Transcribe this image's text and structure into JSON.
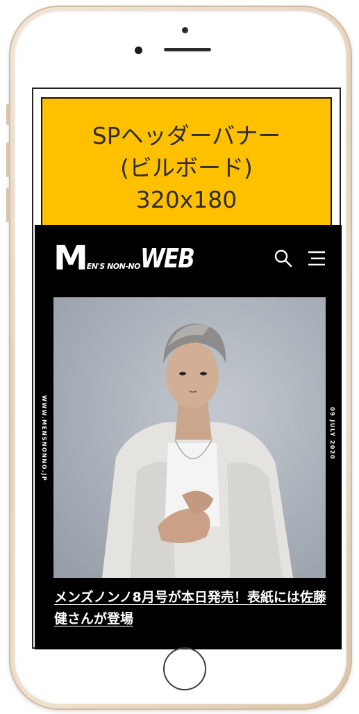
{
  "banner": {
    "line1": "SPヘッダーバナー",
    "line2": "(ビルボード)",
    "line3": "320x180",
    "color": "#ffc000"
  },
  "site": {
    "logo_m": "M",
    "logo_mid": "EN'S NON-NO",
    "logo_web": "WEB",
    "search_icon": "search-icon",
    "menu_icon": "hamburger-menu-icon",
    "side_left_text": "WWW.MENSNONNO.JP",
    "side_right_text": "09 JULY 2020",
    "headline": "メンズノンノ8月号が本日発売！表紙には佐藤 健さんが登場",
    "background": "#000000"
  }
}
